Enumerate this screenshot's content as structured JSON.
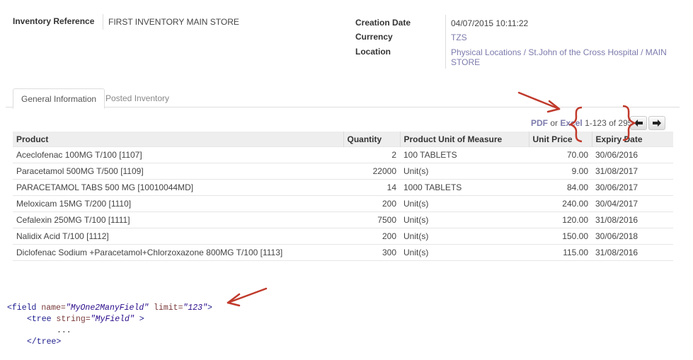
{
  "header": {
    "inventory_reference_label": "Inventory Reference",
    "inventory_reference_value": "FIRST INVENTORY MAIN STORE",
    "creation_date_label": "Creation Date",
    "creation_date_value": "04/07/2015 10:11:22",
    "currency_label": "Currency",
    "currency_value": "TZS",
    "location_label": "Location",
    "location_value_line1": "Physical Locations / St.John of the Cross Hospital / MAIN",
    "location_value_line2": "STORE"
  },
  "tabs": [
    {
      "label": "General Information",
      "active": true
    },
    {
      "label": "Posted Inventory",
      "active": false
    }
  ],
  "pager": {
    "pdf_label": "PDF",
    "or_label": "or",
    "excel_label": "Excel",
    "range_text": "1-123 of 295",
    "prev_icon": "arrow-left-icon",
    "next_icon": "arrow-right-icon"
  },
  "table": {
    "columns": [
      "Product",
      "Quantity",
      "Product Unit of Measure",
      "Unit Price",
      "Expiry Date"
    ],
    "rows": [
      {
        "product": "Aceclofenac 100MG T/100 [1107]",
        "quantity": "2",
        "uom": "100 TABLETS",
        "unit_price": "70.00",
        "expiry": "30/06/2016"
      },
      {
        "product": "Paracetamol 500MG T/500 [1109]",
        "quantity": "22000",
        "uom": "Unit(s)",
        "unit_price": "9.00",
        "expiry": "31/08/2017"
      },
      {
        "product": "PARACETAMOL TABS 500 MG [10010044MD]",
        "quantity": "14",
        "uom": "1000 TABLETS",
        "unit_price": "84.00",
        "expiry": "30/06/2017"
      },
      {
        "product": "Meloxicam 15MG T/200 [1110]",
        "quantity": "200",
        "uom": "Unit(s)",
        "unit_price": "240.00",
        "expiry": "30/04/2017"
      },
      {
        "product": "Cefalexin 250MG T/100 [1111]",
        "quantity": "7500",
        "uom": "Unit(s)",
        "unit_price": "120.00",
        "expiry": "31/08/2016"
      },
      {
        "product": "Nalidix Acid T/100 [1112]",
        "quantity": "200",
        "uom": "Unit(s)",
        "unit_price": "150.00",
        "expiry": "30/06/2018"
      },
      {
        "product": "Diclofenac Sodium +Paracetamol+Chlorzoxazone 800MG T/100 [1113]",
        "quantity": "300",
        "uom": "Unit(s)",
        "unit_price": "115.00",
        "expiry": "31/08/2016"
      }
    ]
  },
  "code": {
    "line1_open": "<field ",
    "line1_name_attr": "name=",
    "line1_name_val": "\"MyOne2ManyField\"",
    "line1_limit_attr": " limit=",
    "line1_limit_val": "\"123\"",
    "line1_close": ">",
    "line2_open": "<tree ",
    "line2_attr": "string=",
    "line2_val": "\"MyField\"",
    "line2_close": " >",
    "line3": "...",
    "line4": "</tree>"
  },
  "annotation_color": "#c0392b"
}
